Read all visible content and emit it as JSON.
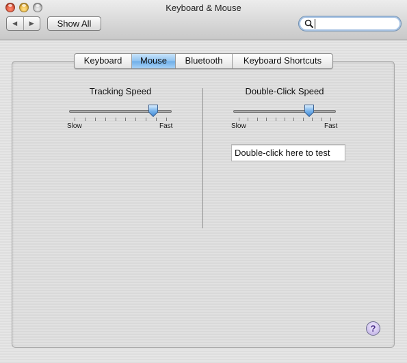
{
  "window": {
    "title": "Keyboard & Mouse"
  },
  "toolbar": {
    "back_icon": "left-arrow",
    "forward_icon": "right-arrow",
    "show_all_label": "Show All",
    "search": {
      "value": "",
      "placeholder": "",
      "icon": "magnifier"
    }
  },
  "tabs": [
    {
      "label": "Keyboard",
      "selected": false
    },
    {
      "label": "Mouse",
      "selected": true
    },
    {
      "label": "Bluetooth",
      "selected": false
    },
    {
      "label": "Keyboard Shortcuts",
      "selected": false
    }
  ],
  "tracking": {
    "title": "Tracking Speed",
    "min_label": "Slow",
    "max_label": "Fast",
    "tick_count": 10,
    "value_fraction": 0.86
  },
  "double_click": {
    "title": "Double-Click Speed",
    "min_label": "Slow",
    "max_label": "Fast",
    "tick_count": 11,
    "value_fraction": 0.77,
    "test_area_label": "Double-click here to test"
  },
  "help": {
    "label": "?"
  },
  "colors": {
    "accent": "#7bb6ec",
    "help": "#b9a8e0"
  }
}
